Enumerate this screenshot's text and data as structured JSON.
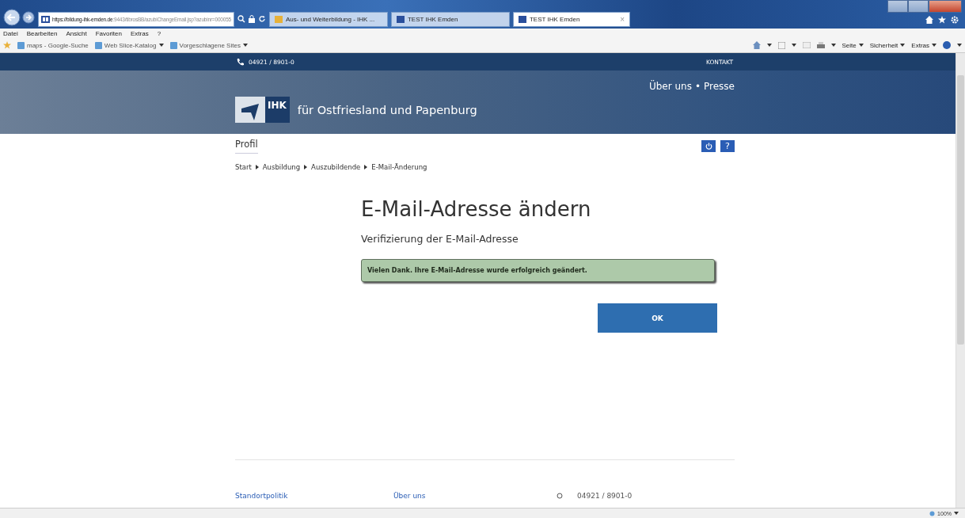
{
  "browser": {
    "address": {
      "host": "https://bildung-ihk-emden.de",
      "path": ":9443/tibrosBB/azubiChangeEmail.jsp?azubinr=000055"
    },
    "tabs": [
      {
        "label": "Aus- und Weiterbildung - IHK ...",
        "selected": false
      },
      {
        "label": "TEST IHK Emden",
        "selected": false
      },
      {
        "label": "TEST IHK Emden",
        "selected": true
      }
    ],
    "close_tab": "×",
    "menu": [
      "Datei",
      "Bearbeiten",
      "Ansicht",
      "Favoriten",
      "Extras",
      "?"
    ],
    "favorites": [
      {
        "label": "maps - Google-Suche",
        "dropdown": false
      },
      {
        "label": "Web Slice-Katalog",
        "dropdown": true
      },
      {
        "label": "Vorgeschlagene Sites",
        "dropdown": true
      }
    ],
    "command_bar": [
      "Seite",
      "Sicherheit",
      "Extras"
    ],
    "zoom": "100%"
  },
  "site": {
    "phone": "04921 / 8901-0",
    "contact": "KONTAKT",
    "nav": [
      "Über uns",
      "Presse"
    ],
    "nav_separator": "•",
    "logo": "IHK",
    "org": "für Ostfriesland und Papenburg"
  },
  "page": {
    "section_tab": "Profil",
    "help_button": "?",
    "breadcrumb": [
      "Start",
      "Ausbildung",
      "Auszubildende",
      "E-Mail-Änderung"
    ],
    "title": "E-Mail-Adresse ändern",
    "subtitle": "Verifizierung der E-Mail-Adresse",
    "message": "Vielen Dank. Ihre E-Mail-Adresse wurde erfolgreich geändert.",
    "ok_button": "OK"
  },
  "footer": {
    "links": [
      "Standortpolitik",
      "Über uns"
    ],
    "phone": "04921 / 8901-0"
  }
}
